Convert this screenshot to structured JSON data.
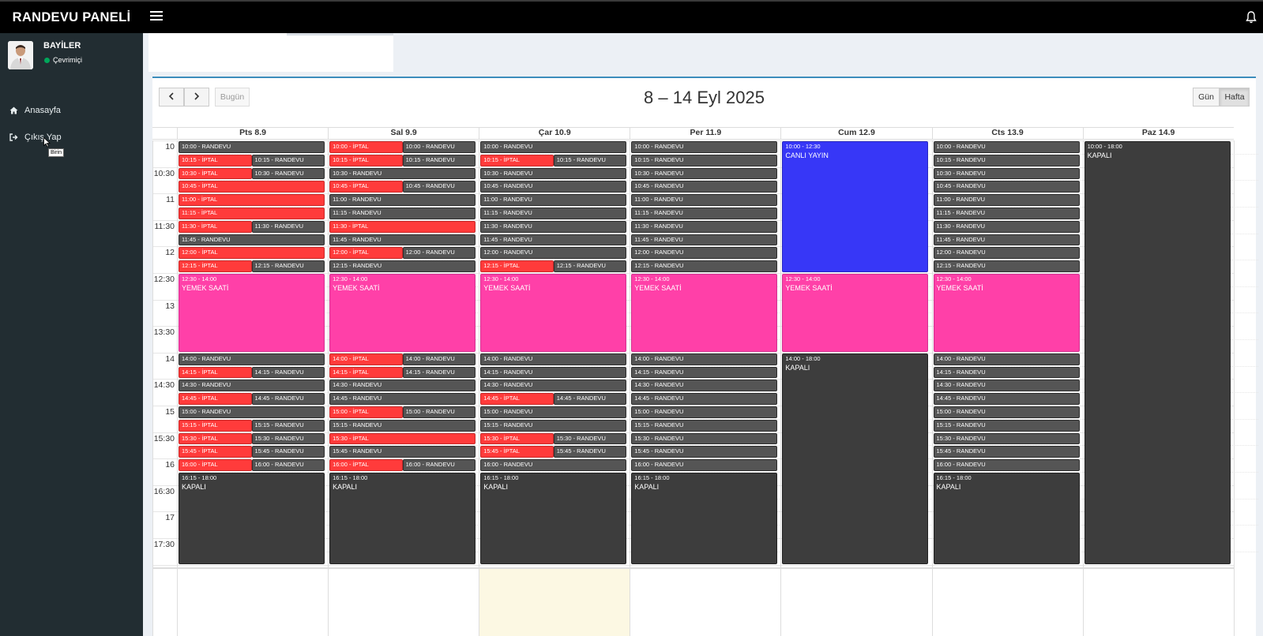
{
  "app": {
    "title": "RANDEVU PANELİ"
  },
  "user": {
    "name": "BAYİLER",
    "status": "Çevrimiçi"
  },
  "nav": [
    {
      "label": "Anasayfa",
      "icon": "home-icon"
    },
    {
      "label": "Çıkış Yap",
      "icon": "sign-out-icon"
    }
  ],
  "tooltip": "Birin",
  "toolbar": {
    "prev": "‹",
    "next": "›",
    "today": "Bugün",
    "title": "8 – 14 Eyl 2025",
    "views": [
      "Gün",
      "Hafta"
    ],
    "active_view": "Hafta"
  },
  "days": [
    "Pts 8.9",
    "Sal 9.9",
    "Çar 10.9",
    "Per 11.9",
    "Cum 12.9",
    "Cts 13.9",
    "Paz 14.9"
  ],
  "times": [
    "10",
    "10:30",
    "11",
    "11:30",
    "12",
    "12:30",
    "13",
    "13:30",
    "14",
    "14:30",
    "15",
    "15:30",
    "16",
    "16:30",
    "17",
    "17:30"
  ],
  "events": [
    [
      {
        "s": "10:00",
        "t": "randevu",
        "label": "10:00 - RANDEVU"
      },
      {
        "s": "10:15",
        "t": "iptal",
        "label": "10:15 - İPTAL",
        "col": 0,
        "of": 2
      },
      {
        "s": "10:15",
        "t": "randevu",
        "label": "10:15 - RANDEVU",
        "col": 1,
        "of": 2
      },
      {
        "s": "10:30",
        "t": "iptal",
        "label": "10:30 - İPTAL",
        "col": 0,
        "of": 2
      },
      {
        "s": "10:30",
        "t": "randevu",
        "label": "10:30 - RANDEVU",
        "col": 1,
        "of": 2
      },
      {
        "s": "10:45",
        "t": "iptal",
        "label": "10:45 - İPTAL"
      },
      {
        "s": "11:00",
        "t": "iptal",
        "label": "11:00 - İPTAL"
      },
      {
        "s": "11:15",
        "t": "iptal",
        "label": "11:15 - İPTAL"
      },
      {
        "s": "11:30",
        "t": "iptal",
        "label": "11:30 - İPTAL",
        "col": 0,
        "of": 2
      },
      {
        "s": "11:30",
        "t": "randevu",
        "label": "11:30 - RANDEVU",
        "col": 1,
        "of": 2
      },
      {
        "s": "11:45",
        "t": "randevu",
        "label": "11:45 - RANDEVU"
      },
      {
        "s": "12:00",
        "t": "iptal",
        "label": "12:00 - İPTAL"
      },
      {
        "s": "12:15",
        "t": "iptal",
        "label": "12:15 - İPTAL",
        "col": 0,
        "of": 2
      },
      {
        "s": "12:15",
        "t": "randevu",
        "label": "12:15 - RANDEVU",
        "col": 1,
        "of": 2
      },
      {
        "s": "12:30",
        "e": "14:00",
        "t": "lunch",
        "time": "12:30 - 14:00",
        "name": "YEMEK SAATİ"
      },
      {
        "s": "14:00",
        "t": "randevu",
        "label": "14:00 - RANDEVU"
      },
      {
        "s": "14:15",
        "t": "iptal",
        "label": "14:15 - İPTAL",
        "col": 0,
        "of": 2
      },
      {
        "s": "14:15",
        "t": "randevu",
        "label": "14:15 - RANDEVU",
        "col": 1,
        "of": 2
      },
      {
        "s": "14:30",
        "t": "randevu",
        "label": "14:30 - RANDEVU"
      },
      {
        "s": "14:45",
        "t": "iptal",
        "label": "14:45 - İPTAL",
        "col": 0,
        "of": 2
      },
      {
        "s": "14:45",
        "t": "randevu",
        "label": "14:45 - RANDEVU",
        "col": 1,
        "of": 2
      },
      {
        "s": "15:00",
        "t": "randevu",
        "label": "15:00 - RANDEVU"
      },
      {
        "s": "15:15",
        "t": "iptal",
        "label": "15:15 - İPTAL",
        "col": 0,
        "of": 2
      },
      {
        "s": "15:15",
        "t": "randevu",
        "label": "15:15 - RANDEVU",
        "col": 1,
        "of": 2
      },
      {
        "s": "15:30",
        "t": "iptal",
        "label": "15:30 - İPTAL",
        "col": 0,
        "of": 2
      },
      {
        "s": "15:30",
        "t": "randevu",
        "label": "15:30 - RANDEVU",
        "col": 1,
        "of": 2
      },
      {
        "s": "15:45",
        "t": "iptal",
        "label": "15:45 - İPTAL",
        "col": 0,
        "of": 2
      },
      {
        "s": "15:45",
        "t": "randevu",
        "label": "15:45 - RANDEVU",
        "col": 1,
        "of": 2
      },
      {
        "s": "16:00",
        "t": "iptal",
        "label": "16:00 - İPTAL",
        "col": 0,
        "of": 2
      },
      {
        "s": "16:00",
        "t": "randevu",
        "label": "16:00 - RANDEVU",
        "col": 1,
        "of": 2
      },
      {
        "s": "16:15",
        "e": "18:00",
        "t": "closed",
        "time": "16:15 - 18:00",
        "name": "KAPALI"
      }
    ],
    [
      {
        "s": "10:00",
        "t": "iptal",
        "label": "10:00 - İPTAL",
        "col": 0,
        "of": 2
      },
      {
        "s": "10:00",
        "t": "randevu",
        "label": "10:00 - RANDEVU",
        "col": 1,
        "of": 2
      },
      {
        "s": "10:15",
        "t": "iptal",
        "label": "10:15 - İPTAL",
        "col": 0,
        "of": 2
      },
      {
        "s": "10:15",
        "t": "randevu",
        "label": "10:15 - RANDEVU",
        "col": 1,
        "of": 2
      },
      {
        "s": "10:30",
        "t": "randevu",
        "label": "10:30 - RANDEVU"
      },
      {
        "s": "10:45",
        "t": "iptal",
        "label": "10:45 - İPTAL",
        "col": 0,
        "of": 2
      },
      {
        "s": "10:45",
        "t": "randevu",
        "label": "10:45 - RANDEVU",
        "col": 1,
        "of": 2
      },
      {
        "s": "11:00",
        "t": "randevu",
        "label": "11:00 - RANDEVU"
      },
      {
        "s": "11:15",
        "t": "randevu",
        "label": "11:15 - RANDEVU"
      },
      {
        "s": "11:30",
        "t": "iptal",
        "label": "11:30 - İPTAL"
      },
      {
        "s": "11:45",
        "t": "randevu",
        "label": "11:45 - RANDEVU"
      },
      {
        "s": "12:00",
        "t": "iptal",
        "label": "12:00 - İPTAL",
        "col": 0,
        "of": 2
      },
      {
        "s": "12:00",
        "t": "randevu",
        "label": "12:00 - RANDEVU",
        "col": 1,
        "of": 2
      },
      {
        "s": "12:15",
        "t": "randevu",
        "label": "12:15 - RANDEVU"
      },
      {
        "s": "12:30",
        "e": "14:00",
        "t": "lunch",
        "time": "12:30 - 14:00",
        "name": "YEMEK SAATİ"
      },
      {
        "s": "14:00",
        "t": "iptal",
        "label": "14:00 - İPTAL",
        "col": 0,
        "of": 2
      },
      {
        "s": "14:00",
        "t": "randevu",
        "label": "14:00 - RANDEVU",
        "col": 1,
        "of": 2
      },
      {
        "s": "14:15",
        "t": "iptal",
        "label": "14:15 - İPTAL",
        "col": 0,
        "of": 2
      },
      {
        "s": "14:15",
        "t": "randevu",
        "label": "14:15 - RANDEVU",
        "col": 1,
        "of": 2
      },
      {
        "s": "14:30",
        "t": "randevu",
        "label": "14:30 - RANDEVU"
      },
      {
        "s": "14:45",
        "t": "randevu",
        "label": "14:45 - RANDEVU"
      },
      {
        "s": "15:00",
        "t": "iptal",
        "label": "15:00 - İPTAL",
        "col": 0,
        "of": 2
      },
      {
        "s": "15:00",
        "t": "randevu",
        "label": "15:00 - RANDEVU",
        "col": 1,
        "of": 2
      },
      {
        "s": "15:15",
        "t": "randevu",
        "label": "15:15 - RANDEVU"
      },
      {
        "s": "15:30",
        "t": "iptal",
        "label": "15:30 - İPTAL"
      },
      {
        "s": "15:45",
        "t": "randevu",
        "label": "15:45 - RANDEVU"
      },
      {
        "s": "16:00",
        "t": "iptal",
        "label": "16:00 - İPTAL",
        "col": 0,
        "of": 2
      },
      {
        "s": "16:00",
        "t": "randevu",
        "label": "16:00 - RANDEVU",
        "col": 1,
        "of": 2
      },
      {
        "s": "16:15",
        "e": "18:00",
        "t": "closed",
        "time": "16:15 - 18:00",
        "name": "KAPALI"
      }
    ],
    [
      {
        "s": "10:00",
        "t": "randevu",
        "label": "10:00 - RANDEVU"
      },
      {
        "s": "10:15",
        "t": "iptal",
        "label": "10:15 - İPTAL",
        "col": 0,
        "of": 2
      },
      {
        "s": "10:15",
        "t": "randevu",
        "label": "10:15 - RANDEVU",
        "col": 1,
        "of": 2
      },
      {
        "s": "10:30",
        "t": "randevu",
        "label": "10:30 - RANDEVU"
      },
      {
        "s": "10:45",
        "t": "randevu",
        "label": "10:45 - RANDEVU"
      },
      {
        "s": "11:00",
        "t": "randevu",
        "label": "11:00 - RANDEVU"
      },
      {
        "s": "11:15",
        "t": "randevu",
        "label": "11:15 - RANDEVU"
      },
      {
        "s": "11:30",
        "t": "randevu",
        "label": "11:30 - RANDEVU"
      },
      {
        "s": "11:45",
        "t": "randevu",
        "label": "11:45 - RANDEVU"
      },
      {
        "s": "12:00",
        "t": "randevu",
        "label": "12:00 - RANDEVU"
      },
      {
        "s": "12:15",
        "t": "iptal",
        "label": "12:15 - İPTAL",
        "col": 0,
        "of": 2
      },
      {
        "s": "12:15",
        "t": "randevu",
        "label": "12:15 - RANDEVU",
        "col": 1,
        "of": 2
      },
      {
        "s": "12:30",
        "e": "14:00",
        "t": "lunch",
        "time": "12:30 - 14:00",
        "name": "YEMEK SAATİ"
      },
      {
        "s": "14:00",
        "t": "randevu",
        "label": "14:00 - RANDEVU"
      },
      {
        "s": "14:15",
        "t": "randevu",
        "label": "14:15 - RANDEVU"
      },
      {
        "s": "14:30",
        "t": "randevu",
        "label": "14:30 - RANDEVU"
      },
      {
        "s": "14:45",
        "t": "iptal",
        "label": "14:45 - İPTAL",
        "col": 0,
        "of": 2
      },
      {
        "s": "14:45",
        "t": "randevu",
        "label": "14:45 - RANDEVU",
        "col": 1,
        "of": 2
      },
      {
        "s": "15:00",
        "t": "randevu",
        "label": "15:00 - RANDEVU"
      },
      {
        "s": "15:15",
        "t": "randevu",
        "label": "15:15 - RANDEVU"
      },
      {
        "s": "15:30",
        "t": "iptal",
        "label": "15:30 - İPTAL",
        "col": 0,
        "of": 2
      },
      {
        "s": "15:30",
        "t": "randevu",
        "label": "15:30 - RANDEVU",
        "col": 1,
        "of": 2
      },
      {
        "s": "15:45",
        "t": "iptal",
        "label": "15:45 - İPTAL",
        "col": 0,
        "of": 2
      },
      {
        "s": "15:45",
        "t": "randevu",
        "label": "15:45 - RANDEVU",
        "col": 1,
        "of": 2
      },
      {
        "s": "16:00",
        "t": "randevu",
        "label": "16:00 - RANDEVU"
      },
      {
        "s": "16:15",
        "e": "18:00",
        "t": "closed",
        "time": "16:15 - 18:00",
        "name": "KAPALI"
      }
    ],
    [
      {
        "s": "10:00",
        "t": "randevu",
        "label": "10:00 - RANDEVU"
      },
      {
        "s": "10:15",
        "t": "randevu",
        "label": "10:15 - RANDEVU"
      },
      {
        "s": "10:30",
        "t": "randevu",
        "label": "10:30 - RANDEVU"
      },
      {
        "s": "10:45",
        "t": "randevu",
        "label": "10:45 - RANDEVU"
      },
      {
        "s": "11:00",
        "t": "randevu",
        "label": "11:00 - RANDEVU"
      },
      {
        "s": "11:15",
        "t": "randevu",
        "label": "11:15 - RANDEVU"
      },
      {
        "s": "11:30",
        "t": "randevu",
        "label": "11:30 - RANDEVU"
      },
      {
        "s": "11:45",
        "t": "randevu",
        "label": "11:45 - RANDEVU"
      },
      {
        "s": "12:00",
        "t": "randevu",
        "label": "12:00 - RANDEVU"
      },
      {
        "s": "12:15",
        "t": "randevu",
        "label": "12:15 - RANDEVU"
      },
      {
        "s": "12:30",
        "e": "14:00",
        "t": "lunch",
        "time": "12:30 - 14:00",
        "name": "YEMEK SAATİ"
      },
      {
        "s": "14:00",
        "t": "randevu",
        "label": "14:00 - RANDEVU"
      },
      {
        "s": "14:15",
        "t": "randevu",
        "label": "14:15 - RANDEVU"
      },
      {
        "s": "14:30",
        "t": "randevu",
        "label": "14:30 - RANDEVU"
      },
      {
        "s": "14:45",
        "t": "randevu",
        "label": "14:45 - RANDEVU"
      },
      {
        "s": "15:00",
        "t": "randevu",
        "label": "15:00 - RANDEVU"
      },
      {
        "s": "15:15",
        "t": "randevu",
        "label": "15:15 - RANDEVU"
      },
      {
        "s": "15:30",
        "t": "randevu",
        "label": "15:30 - RANDEVU"
      },
      {
        "s": "15:45",
        "t": "randevu",
        "label": "15:45 - RANDEVU"
      },
      {
        "s": "16:00",
        "t": "randevu",
        "label": "16:00 - RANDEVU"
      },
      {
        "s": "16:15",
        "e": "18:00",
        "t": "closed",
        "time": "16:15 - 18:00",
        "name": "KAPALI"
      }
    ],
    [
      {
        "s": "10:00",
        "e": "12:30",
        "t": "live",
        "time": "10:00 - 12:30",
        "name": "CANLI YAYIN"
      },
      {
        "s": "12:30",
        "e": "14:00",
        "t": "lunch",
        "time": "12:30 - 14:00",
        "name": "YEMEK SAATİ"
      },
      {
        "s": "14:00",
        "e": "18:00",
        "t": "closed",
        "time": "14:00 - 18:00",
        "name": "KAPALI"
      }
    ],
    [
      {
        "s": "10:00",
        "t": "randevu",
        "label": "10:00 - RANDEVU"
      },
      {
        "s": "10:15",
        "t": "randevu",
        "label": "10:15 - RANDEVU"
      },
      {
        "s": "10:30",
        "t": "randevu",
        "label": "10:30 - RANDEVU"
      },
      {
        "s": "10:45",
        "t": "randevu",
        "label": "10:45 - RANDEVU"
      },
      {
        "s": "11:00",
        "t": "randevu",
        "label": "11:00 - RANDEVU"
      },
      {
        "s": "11:15",
        "t": "randevu",
        "label": "11:15 - RANDEVU"
      },
      {
        "s": "11:30",
        "t": "randevu",
        "label": "11:30 - RANDEVU"
      },
      {
        "s": "11:45",
        "t": "randevu",
        "label": "11:45 - RANDEVU"
      },
      {
        "s": "12:00",
        "t": "randevu",
        "label": "12:00 - RANDEVU"
      },
      {
        "s": "12:15",
        "t": "randevu",
        "label": "12:15 - RANDEVU"
      },
      {
        "s": "12:30",
        "e": "14:00",
        "t": "lunch",
        "time": "12:30 - 14:00",
        "name": "YEMEK SAATİ"
      },
      {
        "s": "14:00",
        "t": "randevu",
        "label": "14:00 - RANDEVU"
      },
      {
        "s": "14:15",
        "t": "randevu",
        "label": "14:15 - RANDEVU"
      },
      {
        "s": "14:30",
        "t": "randevu",
        "label": "14:30 - RANDEVU"
      },
      {
        "s": "14:45",
        "t": "randevu",
        "label": "14:45 - RANDEVU"
      },
      {
        "s": "15:00",
        "t": "randevu",
        "label": "15:00 - RANDEVU"
      },
      {
        "s": "15:15",
        "t": "randevu",
        "label": "15:15 - RANDEVU"
      },
      {
        "s": "15:30",
        "t": "randevu",
        "label": "15:30 - RANDEVU"
      },
      {
        "s": "15:45",
        "t": "randevu",
        "label": "15:45 - RANDEVU"
      },
      {
        "s": "16:00",
        "t": "randevu",
        "label": "16:00 - RANDEVU"
      },
      {
        "s": "16:15",
        "e": "18:00",
        "t": "closed",
        "time": "16:15 - 18:00",
        "name": "KAPALI"
      }
    ],
    [
      {
        "s": "10:00",
        "e": "18:00",
        "t": "closed",
        "time": "10:00 - 18:00",
        "name": "KAPALI"
      }
    ]
  ],
  "colors": {
    "randevu": "#555555",
    "iptal": "#ff3b3b",
    "lunch": "#ff40a8",
    "closed": "#3d3d3d",
    "live": "#3737f7",
    "accent": "#3c8dbc"
  }
}
